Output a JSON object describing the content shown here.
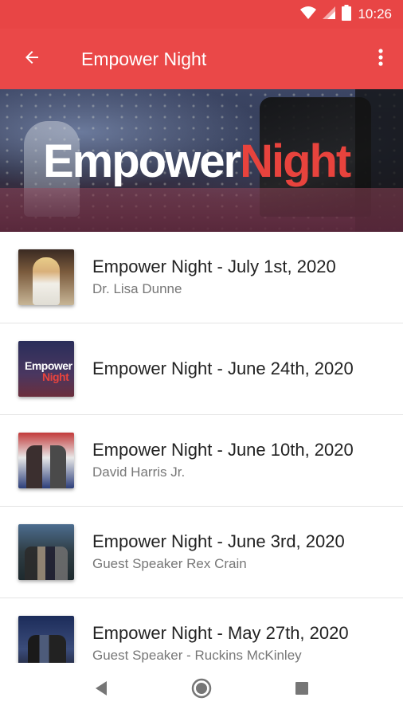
{
  "status_bar": {
    "time": "10:26",
    "icons": [
      "wifi-icon",
      "cell-signal-icon",
      "battery-icon"
    ]
  },
  "app_bar": {
    "title": "Empower Night",
    "back_icon": "back-arrow-icon",
    "menu_icon": "more-vert-icon",
    "color": "#ea4848"
  },
  "hero": {
    "logo_white": "Empower",
    "logo_red": "Night",
    "accent": "#e8433d"
  },
  "episodes": [
    {
      "title": "Empower Night - July 1st, 2020",
      "subtitle": "Dr. Lisa Dunne"
    },
    {
      "title": "Empower Night - June 24th, 2020",
      "subtitle": "",
      "thumb_text_white": "Empower",
      "thumb_text_red": "Night"
    },
    {
      "title": "Empower Night - June 10th, 2020",
      "subtitle": "David Harris Jr."
    },
    {
      "title": "Empower Night - June 3rd, 2020",
      "subtitle": "Guest Speaker Rex Crain"
    },
    {
      "title": "Empower Night - May 27th, 2020",
      "subtitle": "Guest Speaker - Ruckins McKinley"
    }
  ],
  "nav_bar": {
    "icons": [
      "nav-back-icon",
      "nav-home-icon",
      "nav-recents-icon"
    ]
  }
}
